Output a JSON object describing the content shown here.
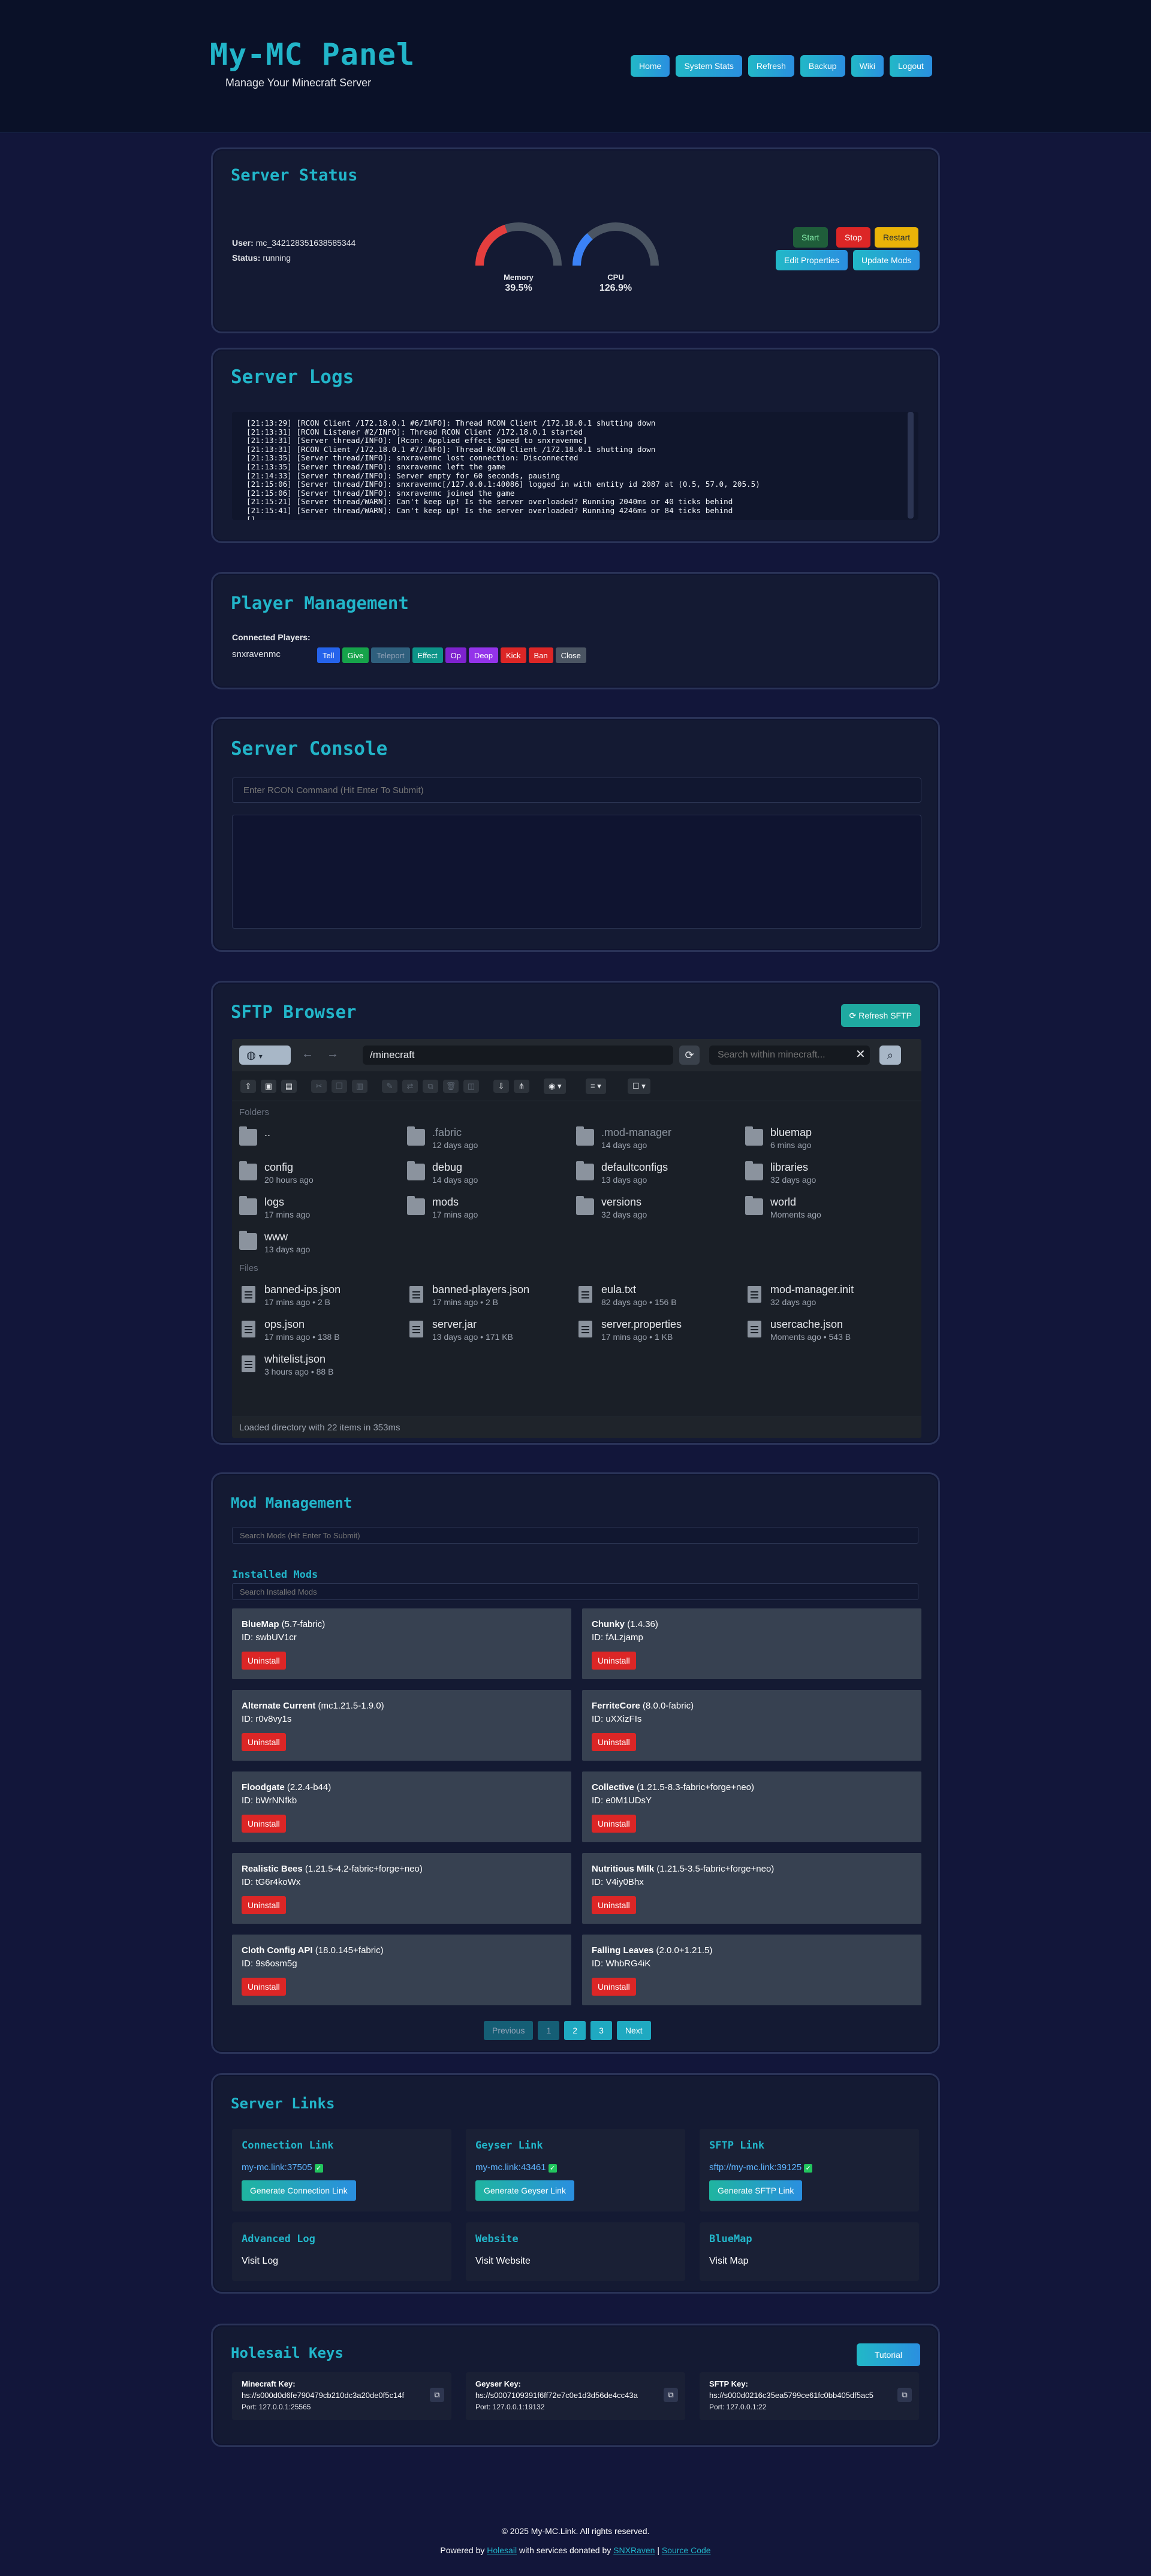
{
  "header": {
    "logo": "My-MC Panel",
    "tagline": "Manage Your Minecraft Server",
    "nav": [
      "Home",
      "System Stats",
      "Refresh",
      "Backup",
      "Wiki",
      "Logout"
    ],
    "accent": "#22b5c9"
  },
  "status": {
    "title": "Server Status",
    "user_label": "User:",
    "user_value": "mc_342128351638585344",
    "status_label": "Status:",
    "status_value": "running",
    "memory_label": "Memory",
    "memory_value": "39.5%",
    "memory_fraction": 0.395,
    "cpu_label": "CPU",
    "cpu_value": "126.9%",
    "cpu_fraction": 0.27,
    "buttons": {
      "start": "Start",
      "stop": "Stop",
      "restart": "Restart",
      "edit": "Edit Properties",
      "update": "Update Mods"
    }
  },
  "logs": {
    "title": "Server Logs",
    "lines": [
      "[21:13:29] [RCON Client /172.18.0.1 #6/INFO]: Thread RCON Client /172.18.0.1 shutting down",
      "[21:13:31] [RCON Listener #2/INFO]: Thread RCON Client /172.18.0.1 started",
      "[21:13:31] [Server thread/INFO]: [Rcon: Applied effect Speed to snxravenmc]",
      "[21:13:31] [RCON Client /172.18.0.1 #7/INFO]: Thread RCON Client /172.18.0.1 shutting down",
      "[21:13:35] [Server thread/INFO]: snxravenmc lost connection: Disconnected",
      "[21:13:35] [Server thread/INFO]: snxravenmc left the game",
      "[21:14:33] [Server thread/INFO]: Server empty for 60 seconds, pausing",
      "[21:15:06] [Server thread/INFO]: snxravenmc[/127.0.0.1:40086] logged in with entity id 2087 at (0.5, 57.0, 205.5)",
      "[21:15:06] [Server thread/INFO]: snxravenmc joined the game",
      "[21:15:21] [Server thread/WARN]: Can't keep up! Is the server overloaded? Running 2040ms or 40 ticks behind",
      "[21:15:41] [Server thread/WARN]: Can't keep up! Is the server overloaded? Running 4246ms or 84 ticks behind",
      "[]"
    ]
  },
  "players": {
    "title": "Player Management",
    "connected_label": "Connected Players:",
    "player": "snxravenmc",
    "actions": [
      "Tell",
      "Give",
      "Teleport",
      "Effect",
      "Op",
      "Deop",
      "Kick",
      "Ban",
      "Close"
    ]
  },
  "console": {
    "title": "Server Console",
    "placeholder": "Enter RCON Command (Hit Enter To Submit)"
  },
  "sftp": {
    "title": "SFTP Browser",
    "refresh": "Refresh SFTP",
    "path": "/minecraft",
    "search_placeholder": "Search within minecraft...",
    "folders_label": "Folders",
    "files_label": "Files",
    "folders": [
      {
        "name": "..",
        "meta": ""
      },
      {
        "name": ".fabric",
        "meta": "12 days ago"
      },
      {
        "name": ".mod-manager",
        "meta": "14 days ago"
      },
      {
        "name": "bluemap",
        "meta": "6 mins ago"
      },
      {
        "name": "config",
        "meta": "20 hours ago"
      },
      {
        "name": "debug",
        "meta": "14 days ago"
      },
      {
        "name": "defaultconfigs",
        "meta": "13 days ago"
      },
      {
        "name": "libraries",
        "meta": "32 days ago"
      },
      {
        "name": "logs",
        "meta": "17 mins ago"
      },
      {
        "name": "mods",
        "meta": "17 mins ago"
      },
      {
        "name": "versions",
        "meta": "32 days ago"
      },
      {
        "name": "world",
        "meta": "Moments ago"
      },
      {
        "name": "www",
        "meta": "13 days ago"
      }
    ],
    "files": [
      {
        "name": "banned-ips.json",
        "meta": "17 mins ago • 2 B"
      },
      {
        "name": "banned-players.json",
        "meta": "17 mins ago • 2 B"
      },
      {
        "name": "eula.txt",
        "meta": "82 days ago • 156 B"
      },
      {
        "name": "mod-manager.init",
        "meta": "32 days ago"
      },
      {
        "name": "ops.json",
        "meta": "17 mins ago • 138 B"
      },
      {
        "name": "server.jar",
        "meta": "13 days ago • 171 KB"
      },
      {
        "name": "server.properties",
        "meta": "17 mins ago • 1 KB"
      },
      {
        "name": "usercache.json",
        "meta": "Moments ago • 543 B"
      },
      {
        "name": "whitelist.json",
        "meta": "3 hours ago • 88 B"
      }
    ],
    "status_text": "Loaded directory with 22 items in 353ms"
  },
  "mods": {
    "title": "Mod Management",
    "search_placeholder": "Search Mods (Hit Enter To Submit)",
    "installed_title": "Installed Mods",
    "installed_placeholder": "Search Installed Mods",
    "id_prefix": "ID: ",
    "uninstall": "Uninstall",
    "list": [
      {
        "name": "BlueMap",
        "version": "(5.7-fabric)",
        "id": "swbUV1cr"
      },
      {
        "name": "Chunky",
        "version": "(1.4.36)",
        "id": "fALzjamp"
      },
      {
        "name": "Alternate Current",
        "version": "(mc1.21.5-1.9.0)",
        "id": "r0v8vy1s"
      },
      {
        "name": "FerriteCore",
        "version": "(8.0.0-fabric)",
        "id": "uXXizFIs"
      },
      {
        "name": "Floodgate",
        "version": "(2.2.4-b44)",
        "id": "bWrNNfkb"
      },
      {
        "name": "Collective",
        "version": "(1.21.5-8.3-fabric+forge+neo)",
        "id": "e0M1UDsY"
      },
      {
        "name": "Realistic Bees",
        "version": "(1.21.5-4.2-fabric+forge+neo)",
        "id": "tG6r4koWx"
      },
      {
        "name": "Nutritious Milk",
        "version": "(1.21.5-3.5-fabric+forge+neo)",
        "id": "V4iy0Bhx"
      },
      {
        "name": "Cloth Config API",
        "version": "(18.0.145+fabric)",
        "id": "9s6osm5g"
      },
      {
        "name": "Falling Leaves",
        "version": "(2.0.0+1.21.5)",
        "id": "WhbRG4iK"
      }
    ],
    "pager": [
      "Previous",
      "1",
      "2",
      "3",
      "Next"
    ]
  },
  "links": {
    "title": "Server Links",
    "connection": {
      "title": "Connection Link",
      "url": "my-mc.link:37505",
      "button": "Generate Connection Link"
    },
    "geyser": {
      "title": "Geyser Link",
      "url": "my-mc.link:43461",
      "button": "Generate Geyser Link"
    },
    "sftp": {
      "title": "SFTP Link",
      "url": "sftp://my-mc.link:39125",
      "button": "Generate SFTP Link"
    },
    "advanced": {
      "title": "Advanced Log",
      "text": "Visit Log"
    },
    "website": {
      "title": "Website",
      "text": "Visit Website"
    },
    "bluemap": {
      "title": "BlueMap",
      "text": "Visit Map"
    },
    "check": "✓"
  },
  "keys": {
    "title": "Holesail Keys",
    "tutorial": "Tutorial",
    "minecraft": {
      "label": "Minecraft Key:",
      "value": "hs://s000d0d6fe790479cb210dc3a20de0f5c14f",
      "port": "Port: 127.0.0.1:25565"
    },
    "geyser": {
      "label": "Geyser Key:",
      "value": "hs://s0007109391f6ff72e7c0e1d3d56de4cc43a",
      "port": "Port: 127.0.0.1:19132"
    },
    "sftp": {
      "label": "SFTP Key:",
      "value": "hs://s000d0216c35ea5799ce61fc0bb405df5ac5",
      "port": "Port: 127.0.0.1:22"
    }
  },
  "footer": {
    "copyright": "© 2025 My-MC.Link. All rights reserved.",
    "powered_prefix": "Powered by",
    "holesail": "Holesail",
    "donated_text": "with services donated by",
    "snxraven": "SNXRaven",
    "separator": "|",
    "source": "Source Code"
  }
}
